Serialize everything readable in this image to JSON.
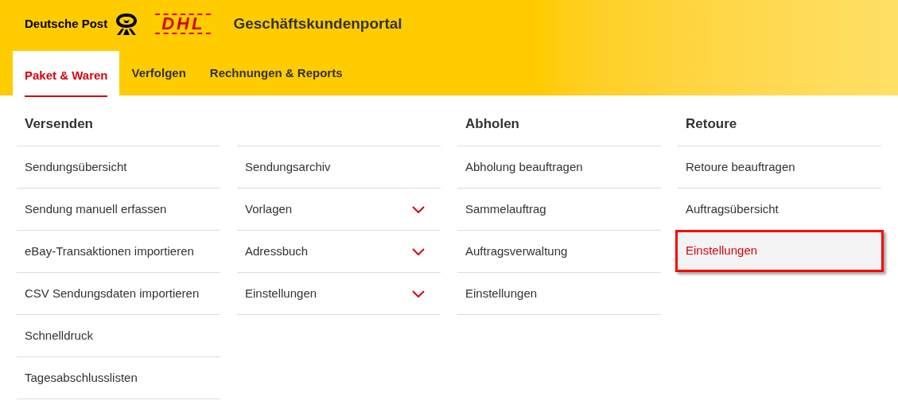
{
  "header": {
    "brand": "Deutsche Post",
    "dhl_logo": "DHL",
    "portal_title": "Geschäftskundenportal"
  },
  "tabs": [
    {
      "label": "Paket & Waren",
      "selected": true
    },
    {
      "label": "Verfolgen",
      "selected": false
    },
    {
      "label": "Rechnungen & Reports",
      "selected": false
    }
  ],
  "menu_columns": [
    {
      "heading": "Versenden",
      "items": [
        {
          "label": "Sendungsübersicht",
          "kind": "link",
          "highlighted": false
        },
        {
          "label": "Sendung manuell erfassen",
          "kind": "link",
          "highlighted": false
        },
        {
          "label": "eBay-Transaktionen importieren",
          "kind": "link",
          "highlighted": false
        },
        {
          "label": "CSV Sendungsdaten importieren",
          "kind": "link",
          "highlighted": false
        },
        {
          "label": "Schnelldruck",
          "kind": "link",
          "highlighted": false
        },
        {
          "label": "Tagesabschlusslisten",
          "kind": "link",
          "highlighted": false
        }
      ]
    },
    {
      "items": [
        {
          "label": "Sendungsarchiv",
          "kind": "link",
          "highlighted": false
        },
        {
          "label": "Vorlagen",
          "kind": "submenu",
          "expanded": false,
          "highlighted": false
        },
        {
          "label": "Adressbuch",
          "kind": "submenu",
          "expanded": false,
          "highlighted": false
        },
        {
          "label": "Einstellungen",
          "kind": "submenu",
          "expanded": false,
          "highlighted": false
        }
      ]
    },
    {
      "heading": "Abholen",
      "items": [
        {
          "label": "Abholung beauftragen",
          "kind": "link",
          "highlighted": false
        },
        {
          "label": "Sammelauftrag",
          "kind": "link",
          "highlighted": false
        },
        {
          "label": "Auftragsverwaltung",
          "kind": "link",
          "highlighted": false
        },
        {
          "label": "Einstellungen",
          "kind": "link",
          "highlighted": false
        }
      ]
    },
    {
      "heading": "Retoure",
      "items": [
        {
          "label": "Retoure beauftragen",
          "kind": "link",
          "highlighted": false
        },
        {
          "label": "Auftragsübersicht",
          "kind": "link",
          "highlighted": false
        },
        {
          "label": "Einstellungen",
          "kind": "link",
          "highlighted": true
        }
      ]
    }
  ]
}
